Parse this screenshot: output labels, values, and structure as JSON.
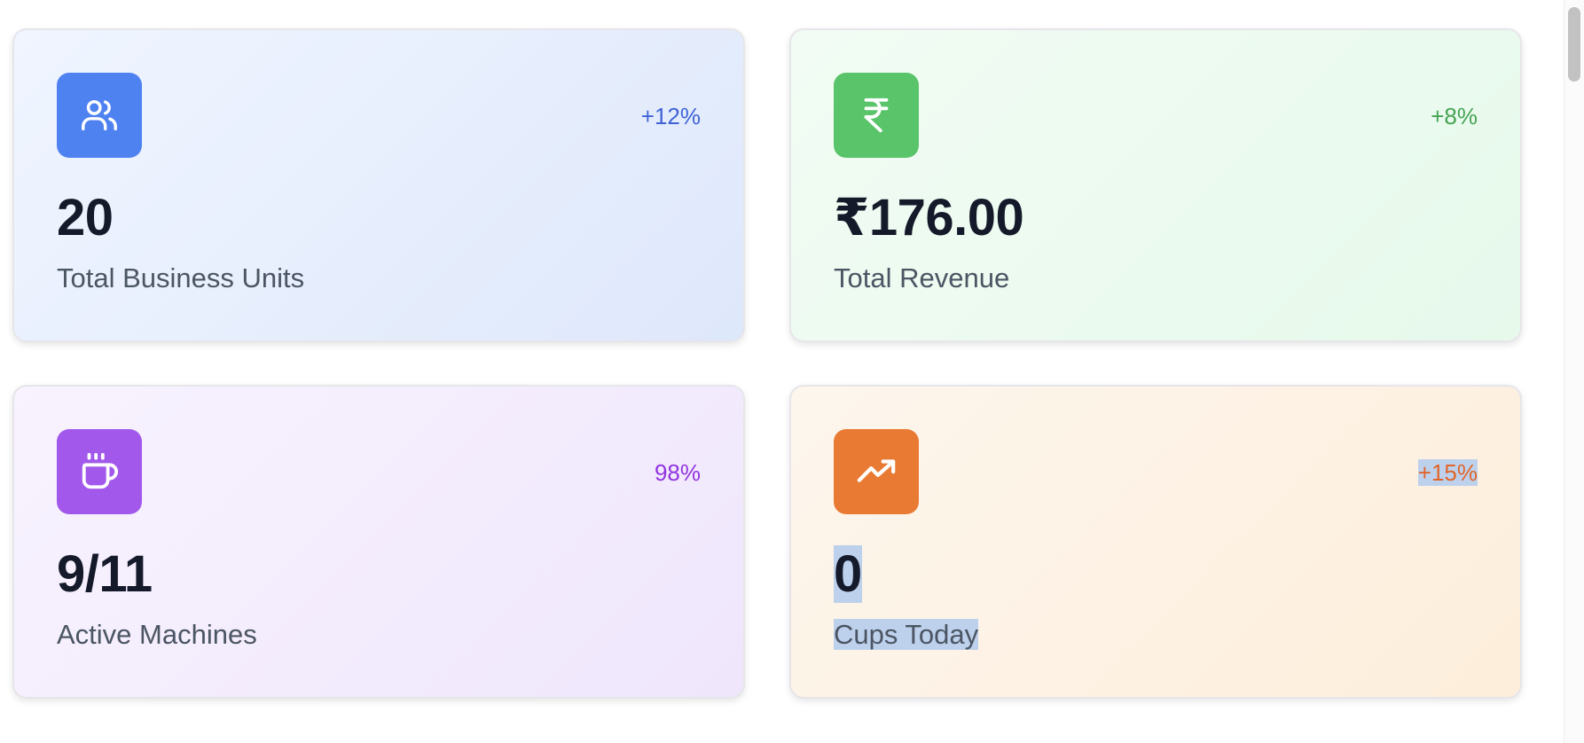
{
  "cards": [
    {
      "icon": "users-icon",
      "change": "+12%",
      "value": "20",
      "label": "Total Business Units",
      "accent": "#4f82f1"
    },
    {
      "icon": "rupee-icon",
      "change": "+8%",
      "value": "₹176.00",
      "label": "Total Revenue",
      "accent": "#5ac46a"
    },
    {
      "icon": "coffee-cup-icon",
      "change": "98%",
      "value": "9/11",
      "label": "Active Machines",
      "accent": "#a259eb"
    },
    {
      "icon": "trending-up-icon",
      "change": "+15%",
      "value": "0",
      "label": "Cups Today",
      "accent": "#e97a33"
    }
  ]
}
